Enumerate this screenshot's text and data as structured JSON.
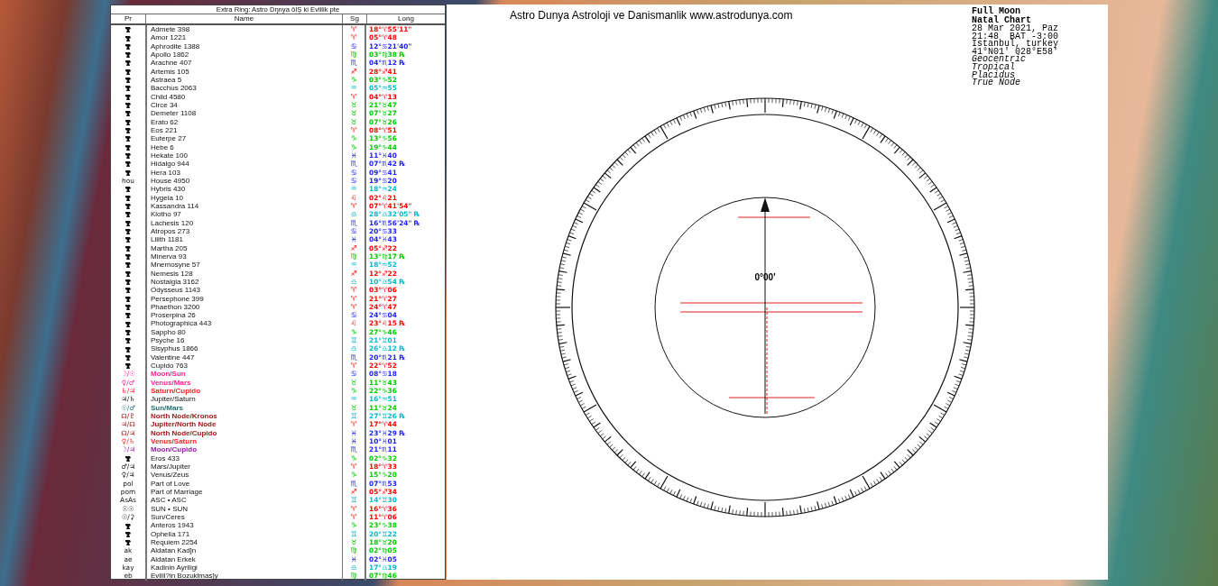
{
  "table": {
    "title": "Extra Ring: Astro Dŋnya ŏİŞ ki Evlilik pte",
    "columns": [
      "Pr",
      "Name",
      "Sg",
      "Long"
    ],
    "rows": [
      {
        "name": "Admete 398",
        "sign": {
          "symbol": "♈",
          "long": "18°♈55'11\"",
          "color": "#ff0000"
        }
      },
      {
        "name": "Amor 1221",
        "sign": {
          "symbol": "♈",
          "long": "05°♈48",
          "color": "#ff0000"
        }
      },
      {
        "name": "Aphrodite 1388",
        "sign": {
          "symbol": "♋",
          "long": "12°♋21'40\"",
          "color": "#2020ff"
        }
      },
      {
        "name": "Apollo 1862",
        "sign": {
          "symbol": "♍",
          "long": "03°♍38 ℞",
          "color": "#00cc00"
        }
      },
      {
        "name": "Arachne 407",
        "sign": {
          "symbol": "♏",
          "long": "04°♏12 ℞",
          "color": "#2020ff"
        }
      },
      {
        "name": "Artemis 105",
        "sign": {
          "symbol": "♐",
          "long": "28°♐41",
          "color": "#ff0000"
        }
      },
      {
        "name": "Astraea 5",
        "sign": {
          "symbol": "♑",
          "long": "03°♑52",
          "color": "#00cc00"
        }
      },
      {
        "name": "Bacchus 2063",
        "sign": {
          "symbol": "♒",
          "long": "05°♒55",
          "color": "#00bbcc"
        }
      },
      {
        "name": "Child 4580",
        "sign": {
          "symbol": "♈",
          "long": "04°♈13",
          "color": "#ff0000"
        }
      },
      {
        "name": "Circe 34",
        "sign": {
          "symbol": "♉",
          "long": "21°♉47",
          "color": "#00cc00"
        }
      },
      {
        "name": "Demeter 1108",
        "sign": {
          "symbol": "♉",
          "long": "07°♉27",
          "color": "#00cc00"
        }
      },
      {
        "name": "Erato 62",
        "sign": {
          "symbol": "♉",
          "long": "07°♉26",
          "color": "#00cc00"
        }
      },
      {
        "name": "Eos 221",
        "sign": {
          "symbol": "♈",
          "long": "08°♈51",
          "color": "#ff0000"
        }
      },
      {
        "name": "Euterpe 27",
        "sign": {
          "symbol": "♑",
          "long": "13°♑56",
          "color": "#00cc00"
        }
      },
      {
        "name": "Hebe 6",
        "sign": {
          "symbol": "♑",
          "long": "19°♑44",
          "color": "#00cc00"
        }
      },
      {
        "name": "Hekate 100",
        "sign": {
          "symbol": "♓",
          "long": "11°♓40",
          "color": "#2020ff"
        }
      },
      {
        "name": "Hidalgo 944",
        "sign": {
          "symbol": "♏",
          "long": "07°♏42 ℞",
          "color": "#2020ff"
        }
      },
      {
        "name": "Hera 103",
        "sign": {
          "symbol": "♋",
          "long": "09°♋41",
          "color": "#2020ff"
        }
      },
      {
        "pr": "hou",
        "name": "House 4950",
        "sign": {
          "symbol": "♋",
          "long": "19°♋20",
          "color": "#2020ff"
        }
      },
      {
        "name": "Hybris 430",
        "sign": {
          "symbol": "♒",
          "long": "18°♒24",
          "color": "#00bbcc"
        }
      },
      {
        "name": "Hygeia 10",
        "sign": {
          "symbol": "♌",
          "long": "02°♌21",
          "color": "#ff0000"
        }
      },
      {
        "name": "Kassandra 114",
        "sign": {
          "symbol": "♈",
          "long": "07°♈41'54\"",
          "color": "#ff0000"
        }
      },
      {
        "name": "Klotho 97",
        "sign": {
          "symbol": "♎",
          "long": "28°♎32'05\" ℞",
          "color": "#00bbcc"
        }
      },
      {
        "name": "Lachesis 120",
        "sign": {
          "symbol": "♏",
          "long": "16°♏56'24\" ℞",
          "color": "#2020ff"
        }
      },
      {
        "name": "Atropos 273",
        "sign": {
          "symbol": "♋",
          "long": "20°♋33",
          "color": "#2020ff"
        }
      },
      {
        "name": "Lilith 1181",
        "sign": {
          "symbol": "♓",
          "long": "04°♓43",
          "color": "#2020ff"
        }
      },
      {
        "name": "Martha 205",
        "sign": {
          "symbol": "♐",
          "long": "05°♐22",
          "color": "#ff0000"
        }
      },
      {
        "name": "Minerva 93",
        "sign": {
          "symbol": "♍",
          "long": "13°♍17 ℞",
          "color": "#00cc00"
        }
      },
      {
        "name": "Mnemosyne 57",
        "sign": {
          "symbol": "♒",
          "long": "18°♒52",
          "color": "#00bbcc"
        }
      },
      {
        "name": "Nemesis 128",
        "sign": {
          "symbol": "♐",
          "long": "12°♐22",
          "color": "#ff0000"
        }
      },
      {
        "name": "Nostalgia 3162",
        "sign": {
          "symbol": "♎",
          "long": "10°♎54 ℞",
          "color": "#00bbcc"
        }
      },
      {
        "name": "Odysseus 1143",
        "sign": {
          "symbol": "♈",
          "long": "03°♈06",
          "color": "#ff0000"
        }
      },
      {
        "name": "Persephone 399",
        "sign": {
          "symbol": "♈",
          "long": "21°♈27",
          "color": "#ff0000"
        }
      },
      {
        "name": "Phaethon 3200",
        "sign": {
          "symbol": "♈",
          "long": "24°♈47",
          "color": "#ff0000"
        }
      },
      {
        "name": "Proserpina 26",
        "sign": {
          "symbol": "♋",
          "long": "24°♋04",
          "color": "#2020ff"
        }
      },
      {
        "name": "Photographica 443",
        "sign": {
          "symbol": "♌",
          "long": "23°♌15 ℞",
          "color": "#ff0000"
        }
      },
      {
        "name": "Sappho 80",
        "sign": {
          "symbol": "♑",
          "long": "27°♑46",
          "color": "#00cc00"
        }
      },
      {
        "name": "Psyche 16",
        "sign": {
          "symbol": "♊",
          "long": "21°♊01",
          "color": "#00bbcc"
        }
      },
      {
        "name": "Sisyphus 1866",
        "sign": {
          "symbol": "♎",
          "long": "26°♎12 ℞",
          "color": "#00bbcc"
        }
      },
      {
        "name": "Valentine 447",
        "sign": {
          "symbol": "♏",
          "long": "20°♏21 ℞",
          "color": "#2020ff"
        }
      },
      {
        "name": "Cupido 763",
        "sign": {
          "symbol": "♈",
          "long": "22°♈52",
          "color": "#ff0000"
        }
      },
      {
        "pr": "☽/☉",
        "name": "Moon/Sun",
        "color": "#ff2090",
        "sign": {
          "symbol": "♋",
          "long": "08°♋18",
          "color": "#2020ff"
        }
      },
      {
        "pr": "♀/♂",
        "name": "Venus/Mars",
        "color": "#ff2090",
        "sign": {
          "symbol": "♉",
          "long": "11°♉43",
          "color": "#00cc00"
        }
      },
      {
        "pr": "♄/♃",
        "name": "Saturn/Cupido",
        "color": "#ff2020",
        "sign": {
          "symbol": "♑",
          "long": "22°♑36",
          "color": "#00cc00"
        }
      },
      {
        "pr": "♃/♄",
        "name": "Jupiter/Saturn",
        "sign": {
          "symbol": "♒",
          "long": "16°♒51",
          "color": "#00bbcc"
        }
      },
      {
        "pr": "☉/♂",
        "name": "Sun/Mars",
        "color": "#207070",
        "sign": {
          "symbol": "♉",
          "long": "11°♉24",
          "color": "#00cc00"
        }
      },
      {
        "pr": "☊/♇",
        "name": "North Node/Kronos",
        "color": "#a01818",
        "sign": {
          "symbol": "♊",
          "long": "27°♊26 ℞",
          "color": "#00bbcc"
        }
      },
      {
        "pr": "♃/☊",
        "name": "Jupiter/North Node",
        "color": "#a01818",
        "sign": {
          "symbol": "♈",
          "long": "17°♈44",
          "color": "#ff0000"
        }
      },
      {
        "pr": "☊/♃",
        "name": "North Node/Cupido",
        "color": "#a01818",
        "sign": {
          "symbol": "♓",
          "long": "23°♓29 ℞",
          "color": "#2020ff"
        }
      },
      {
        "pr": "♀/♄",
        "name": "Venus/Saturn",
        "color": "#ff2020",
        "sign": {
          "symbol": "♓",
          "long": "10°♓01",
          "color": "#2020ff"
        }
      },
      {
        "pr": "☽/♃",
        "name": "Moon/Cupido",
        "color": "#9020a0",
        "sign": {
          "symbol": "♏",
          "long": "21°♏11",
          "color": "#2020ff"
        }
      },
      {
        "name": "Eros 433",
        "sign": {
          "symbol": "♑",
          "long": "02°♑32",
          "color": "#00cc00"
        }
      },
      {
        "pr": "♂/♃",
        "name": "Mars/Jupiter",
        "sign": {
          "symbol": "♈",
          "long": "18°♈33",
          "color": "#ff0000"
        }
      },
      {
        "pr": "♀/♃",
        "name": "Venus/Zeus",
        "sign": {
          "symbol": "♑",
          "long": "15°♑20",
          "color": "#00cc00"
        }
      },
      {
        "pr": "pol",
        "name": "Part of Love",
        "sign": {
          "symbol": "♏",
          "long": "07°♏53",
          "color": "#2020ff"
        }
      },
      {
        "pr": "pom",
        "name": "Part of Marriage",
        "sign": {
          "symbol": "♐",
          "long": "05°♐34",
          "color": "#ff0000"
        }
      },
      {
        "pr": "AsAs",
        "name": "ASC • ASC",
        "sign": {
          "symbol": "♊",
          "long": "14°♊30",
          "color": "#00bbcc"
        }
      },
      {
        "pr": "☉☉",
        "name": "SUN • SUN",
        "sign": {
          "symbol": "♈",
          "long": "16°♈36",
          "color": "#ff0000"
        }
      },
      {
        "pr": "☉/⚳",
        "name": "Sun/Ceres",
        "sign": {
          "symbol": "♈",
          "long": "11°♈06",
          "color": "#ff0000"
        }
      },
      {
        "name": "Anteros 1943",
        "sign": {
          "symbol": "♑",
          "long": "23°♑38",
          "color": "#00cc00"
        }
      },
      {
        "name": "Ophelia 171",
        "sign": {
          "symbol": "♊",
          "long": "20°♊22",
          "color": "#00bbcc"
        }
      },
      {
        "name": "Requiem 2254",
        "sign": {
          "symbol": "♉",
          "long": "18°♉20",
          "color": "#00cc00"
        }
      },
      {
        "pr": "ak",
        "name": "Aldatan Kad]n",
        "sign": {
          "symbol": "♍",
          "long": "02°♍05",
          "color": "#00cc00"
        }
      },
      {
        "pr": "ae",
        "name": "Aldatan Erkek",
        "sign": {
          "symbol": "♓",
          "long": "02°♓05",
          "color": "#2020ff"
        }
      },
      {
        "pr": "kay",
        "name": "Kadinin Ayriligi",
        "sign": {
          "symbol": "♎",
          "long": "17°♎19",
          "color": "#00bbcc"
        }
      },
      {
        "pr": "eb",
        "name": "Evlili?in Bozuklmas]y",
        "sign": {
          "symbol": "♍",
          "long": "07°♍46",
          "color": "#00cc00"
        }
      }
    ]
  },
  "chart": {
    "site_title": "Astro Dunya Astroloji ve Danismanlik www.astrodunya.com",
    "info": {
      "title_lines": [
        "Full Moon",
        "Natal Chart"
      ],
      "detail_lines": [
        "28 Mar 2021, Paz",
        "21:48  BAT -3:00",
        "Istanbul, turkey",
        "41°N01' 028°E58'"
      ],
      "settings_lines": [
        "Geocentric",
        "Tropical",
        "Placidus",
        "True Node"
      ]
    },
    "center_label": "0°00'"
  }
}
